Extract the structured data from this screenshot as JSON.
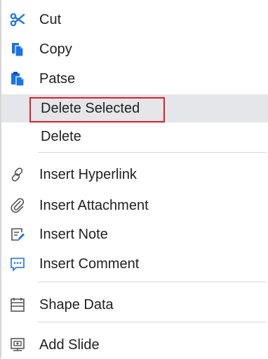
{
  "menu": {
    "items": {
      "cut": {
        "label": "Cut",
        "icon": "scissors-icon"
      },
      "copy": {
        "label": "Copy",
        "icon": "copy-icon"
      },
      "paste": {
        "label": "Patse",
        "icon": "paste-icon"
      },
      "delete_selected": {
        "label": "Delete Selected",
        "highlighted": true
      },
      "delete": {
        "label": "Delete"
      },
      "insert_hyperlink": {
        "label": "Insert Hyperlink",
        "icon": "link-icon"
      },
      "insert_attachment": {
        "label": "Insert Attachment",
        "icon": "paperclip-icon"
      },
      "insert_note": {
        "label": "Insert Note",
        "icon": "note-icon"
      },
      "insert_comment": {
        "label": "Insert Comment",
        "icon": "comment-icon"
      },
      "shape_data": {
        "label": "Shape Data",
        "icon": "shape-data-icon"
      },
      "add_slide": {
        "label": "Add Slide",
        "icon": "slide-icon"
      }
    }
  },
  "colors": {
    "accent_blue": "#1a73e8",
    "highlight_bg": "#e4e6ea",
    "highlight_border": "#e01f25",
    "icon_gray": "#555555"
  }
}
